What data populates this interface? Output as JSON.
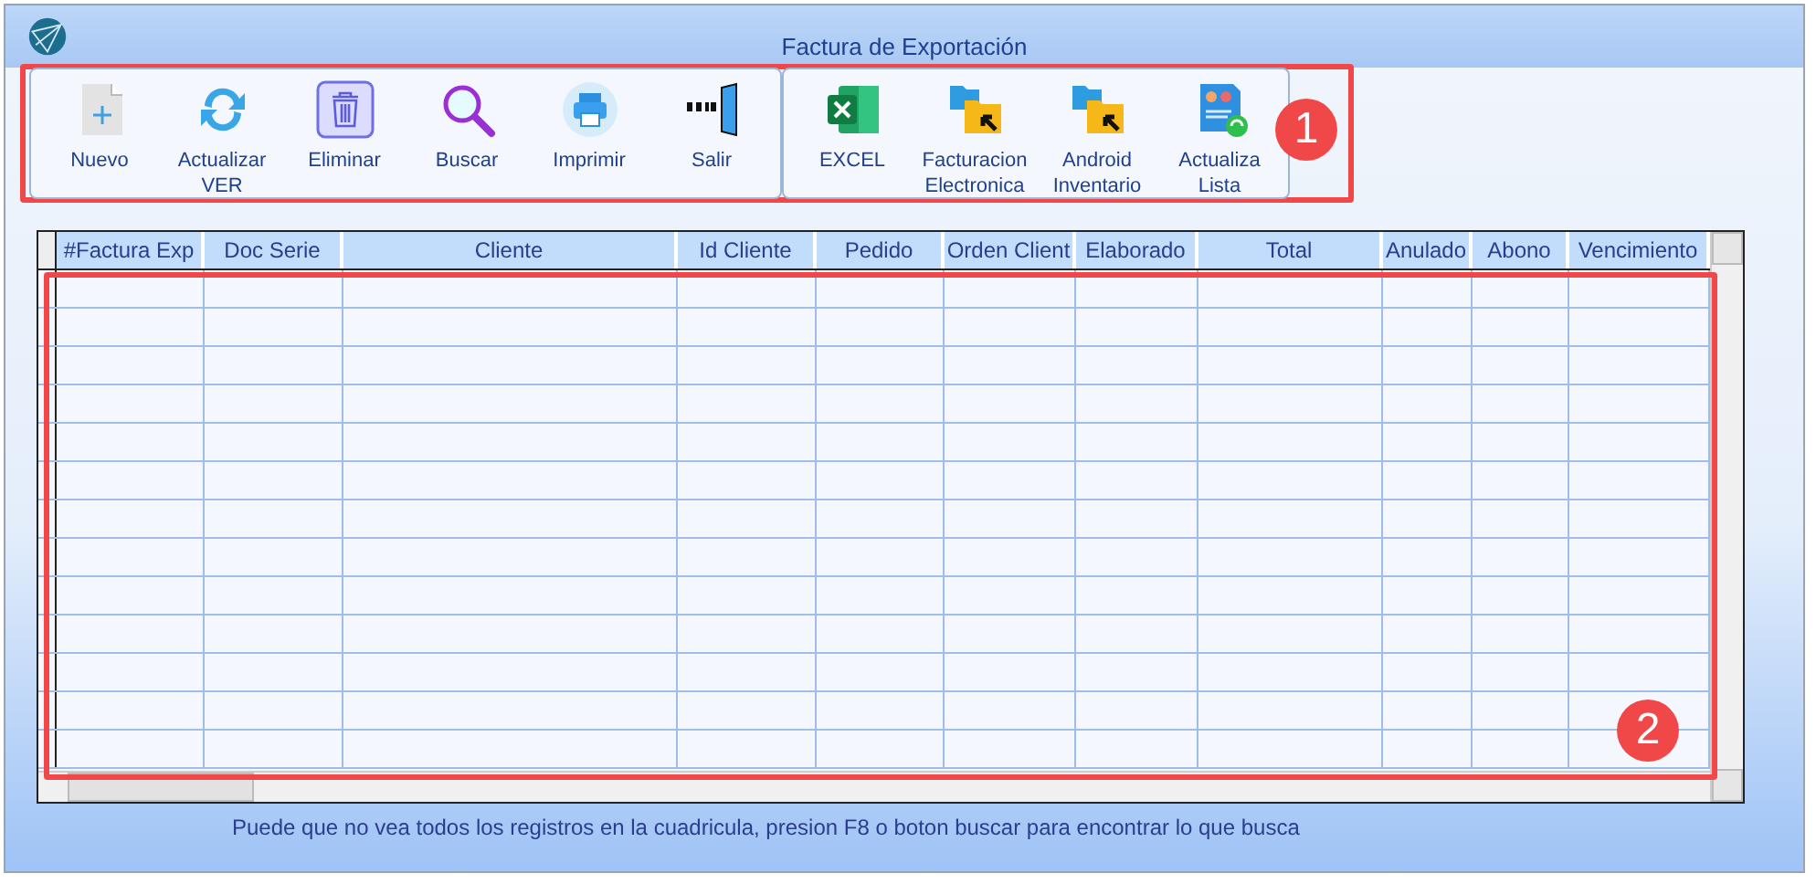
{
  "window": {
    "title": "Factura de Exportación"
  },
  "toolbar": {
    "groups": [
      {
        "buttons": [
          {
            "kind": "new",
            "label": "Nuevo"
          },
          {
            "kind": "refresh",
            "label": "Actualizar VER"
          },
          {
            "kind": "delete",
            "label": "Eliminar"
          },
          {
            "kind": "search",
            "label": "Buscar"
          },
          {
            "kind": "print",
            "label": "Imprimir"
          },
          {
            "kind": "exit",
            "label": "Salir"
          }
        ]
      },
      {
        "buttons": [
          {
            "kind": "excel",
            "label": "EXCEL"
          },
          {
            "kind": "folder",
            "label": "Facturacion Electronica"
          },
          {
            "kind": "folder",
            "label": "Android Inventario"
          },
          {
            "kind": "list",
            "label": "Actualiza Lista"
          }
        ]
      }
    ]
  },
  "table": {
    "columns": [
      "#Factura Exp",
      "Doc Serie",
      "Cliente",
      "Id Cliente",
      "Pedido",
      "Orden Client",
      "Elaborado",
      "Total",
      "Anulado",
      "Abono",
      "Vencimiento"
    ]
  },
  "hint": "Puede que no vea todos los registros en la cuadricula, presion F8 o boton buscar para encontrar lo que busca",
  "annotations": [
    {
      "label": "1"
    },
    {
      "label": "2"
    }
  ]
}
